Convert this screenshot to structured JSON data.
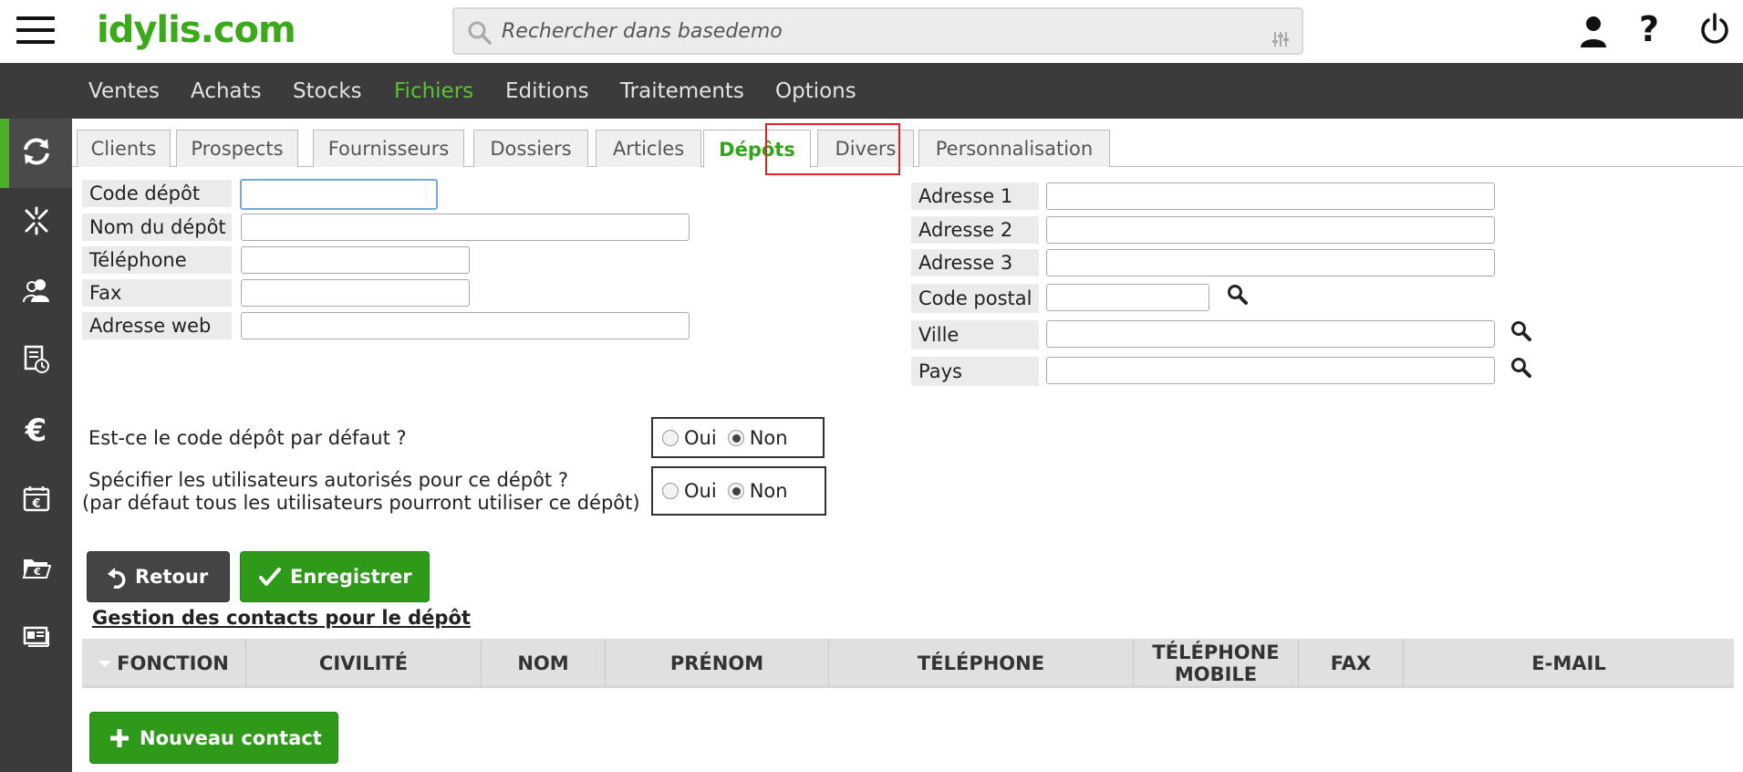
{
  "header": {
    "logo": "idylis.com",
    "search_placeholder": "Rechercher dans basedemo"
  },
  "main_nav": [
    "Ventes",
    "Achats",
    "Stocks",
    "Fichiers",
    "Editions",
    "Traitements",
    "Options"
  ],
  "main_nav_active": "Fichiers",
  "tabs": [
    "Clients",
    "Prospects",
    "Fournisseurs",
    "Dossiers",
    "Articles",
    "Dépôts",
    "Divers",
    "Personnalisation"
  ],
  "tab_active": "Dépôts",
  "form_left": {
    "code_depot": {
      "label": "Code dépôt",
      "value": ""
    },
    "nom_depot": {
      "label": "Nom du dépôt",
      "value": ""
    },
    "telephone": {
      "label": "Téléphone",
      "value": ""
    },
    "fax": {
      "label": "Fax",
      "value": ""
    },
    "adresse_web": {
      "label": "Adresse web",
      "value": ""
    }
  },
  "form_right": {
    "adresse1": {
      "label": "Adresse 1",
      "value": ""
    },
    "adresse2": {
      "label": "Adresse 2",
      "value": ""
    },
    "adresse3": {
      "label": "Adresse 3",
      "value": ""
    },
    "code_postal": {
      "label": "Code postal",
      "value": ""
    },
    "ville": {
      "label": "Ville",
      "value": ""
    },
    "pays": {
      "label": "Pays",
      "value": ""
    }
  },
  "questions": {
    "default_depot": {
      "text": "Est-ce le code dépôt par défaut ?",
      "oui": "Oui",
      "non": "Non",
      "selected": "Non"
    },
    "users": {
      "text_line1": "Spécifier les utilisateurs autorisés pour ce dépôt ?",
      "text_line2": "(par défaut tous les utilisateurs pourront utiliser ce dépôt)",
      "oui": "Oui",
      "non": "Non",
      "selected": "Non"
    }
  },
  "buttons": {
    "retour": "Retour",
    "enregistrer": "Enregistrer",
    "nouveau_contact": "Nouveau contact"
  },
  "contacts_link": "Gestion des contacts pour le dépôt",
  "table": {
    "columns": [
      "FONCTION",
      "CIVILITÉ",
      "NOM",
      "PRÉNOM",
      "TÉLÉPHONE",
      "TÉLÉPHONE MOBILE",
      "FAX",
      "E-MAIL"
    ],
    "mobile_line1": "TÉLÉPHONE",
    "mobile_line2": "MOBILE",
    "rows": []
  }
}
